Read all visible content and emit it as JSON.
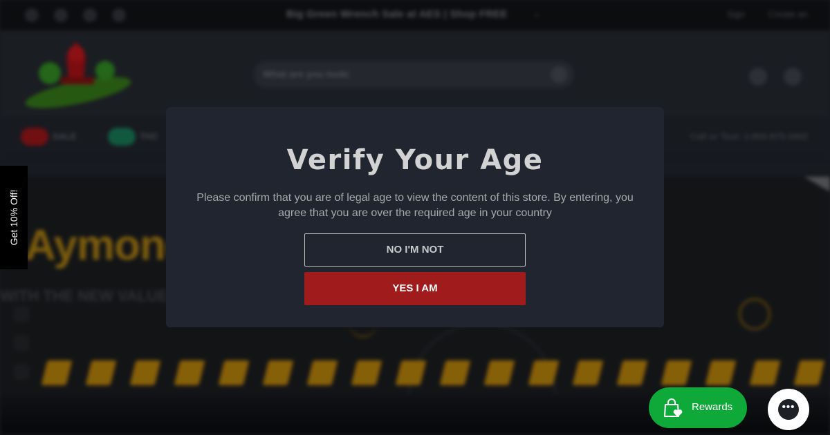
{
  "announcement": {
    "text": "Big Green Wrench Sale at AES | Shop FREE",
    "chevron": "chevron-down-icon"
  },
  "top_links": [
    "Sign",
    "Create an"
  ],
  "social_icons": [
    "facebook-icon",
    "twitter-icon",
    "instagram-icon",
    "tiktok-icon"
  ],
  "search": {
    "placeholder": "What are you looki"
  },
  "header_icons": [
    "account-icon",
    "cart-icon"
  ],
  "nav": {
    "items": [
      {
        "label": "SALE"
      },
      {
        "label": "THC"
      }
    ],
    "right_text": "Call or Text: 1-800-875-3402"
  },
  "hero": {
    "title": "Aymond",
    "subtitle": "WITH THE NEW VALUE STR"
  },
  "modal": {
    "title": "Verify Your Age",
    "body": "Please confirm that you are of legal age to view the content of this store. By entering, you agree that you are over the required age in your country",
    "no_label": "NO I'M NOT",
    "yes_label": "YES I AM",
    "colors": {
      "yes_bg": "#a01b1b",
      "modal_bg": "#21252f"
    }
  },
  "side_tab": {
    "label": "Get 10% Off!"
  },
  "rewards": {
    "label": "Rewards",
    "icon": "shopping-bag-heart-icon",
    "color": "#0fa93a"
  },
  "chat": {
    "icon": "chat-ellipsis-icon",
    "glyph": "•••"
  }
}
